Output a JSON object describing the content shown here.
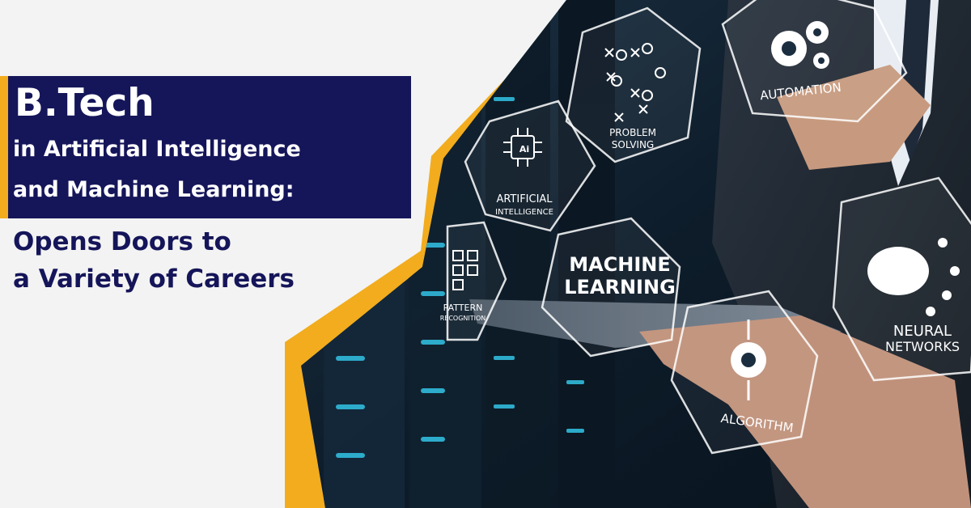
{
  "banner": {
    "title": "B.Tech",
    "title_line2": "in Artificial Intelligence",
    "title_line3": "and Machine Learning:",
    "subtitle_line1": "Opens Doors to",
    "subtitle_line2": "a Variety of Careers"
  },
  "icons": {
    "ai_chip_text": "Ai",
    "artificial_intelligence_1": "ARTIFICIAL",
    "artificial_intelligence_2": "INTELLIGENCE",
    "problem_solving_1": "PROBLEM",
    "problem_solving_2": "SOLVING",
    "automation": "AUTOMATION",
    "machine_learning_1": "MACHINE",
    "machine_learning_2": "LEARNING",
    "pattern_recognition_1": "PATTERN",
    "pattern_recognition_2": "RECOGNITION",
    "algorithm": "ALGORITHM",
    "neural_networks_1": "NEURAL",
    "neural_networks_2": "NETWORKS"
  },
  "colors": {
    "navy": "#15155a",
    "accent": "#f2ac1d",
    "background": "#f3f3f3"
  }
}
